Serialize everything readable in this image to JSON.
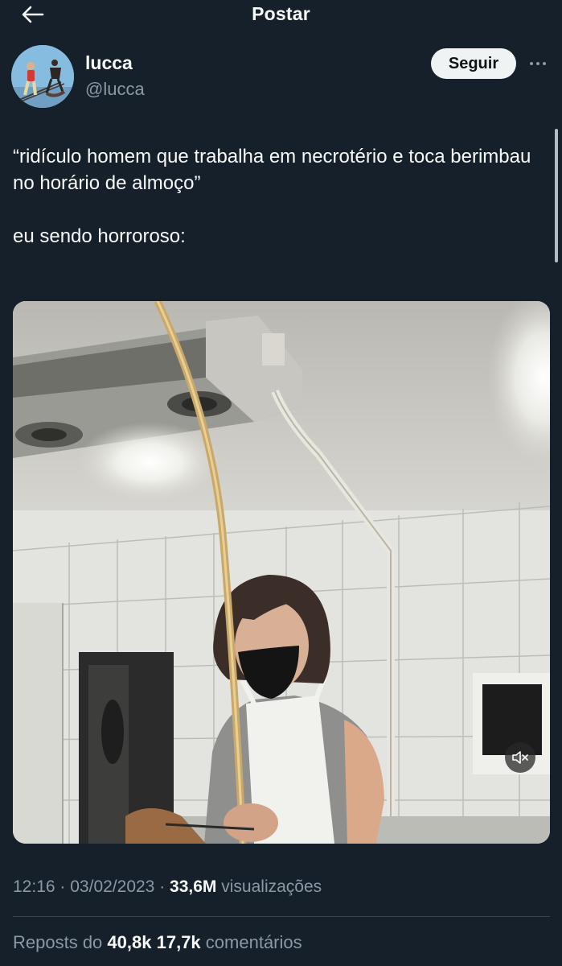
{
  "header": {
    "title": "Postar",
    "back_icon": "arrow-left-icon"
  },
  "author": {
    "name": "lucca",
    "handle": "@lucca",
    "follow_label": "Seguir",
    "more_icon": "more-horizontal-icon"
  },
  "tweet": {
    "line1": "“ridículo homem que trabalha em necrotério e toca berimbau no horário de almoço”",
    "line2": "eu sendo horroroso:"
  },
  "media": {
    "type": "video",
    "mute_icon": "speaker-muted-icon"
  },
  "meta": {
    "time": "12:16",
    "separator": "·",
    "date": "03/02/2023",
    "views_count": "33,6M",
    "views_label": "visualizações"
  },
  "stats": {
    "reposts_label": "Reposts do",
    "reposts_count": "40,8k",
    "comments_count": "17,7k",
    "comments_label": "comentários"
  },
  "colors": {
    "background": "#15202b",
    "text": "#f7f9f9",
    "secondary_text": "#8b98a5",
    "follow_button_bg": "#eff3f4",
    "divider": "#38444d"
  }
}
